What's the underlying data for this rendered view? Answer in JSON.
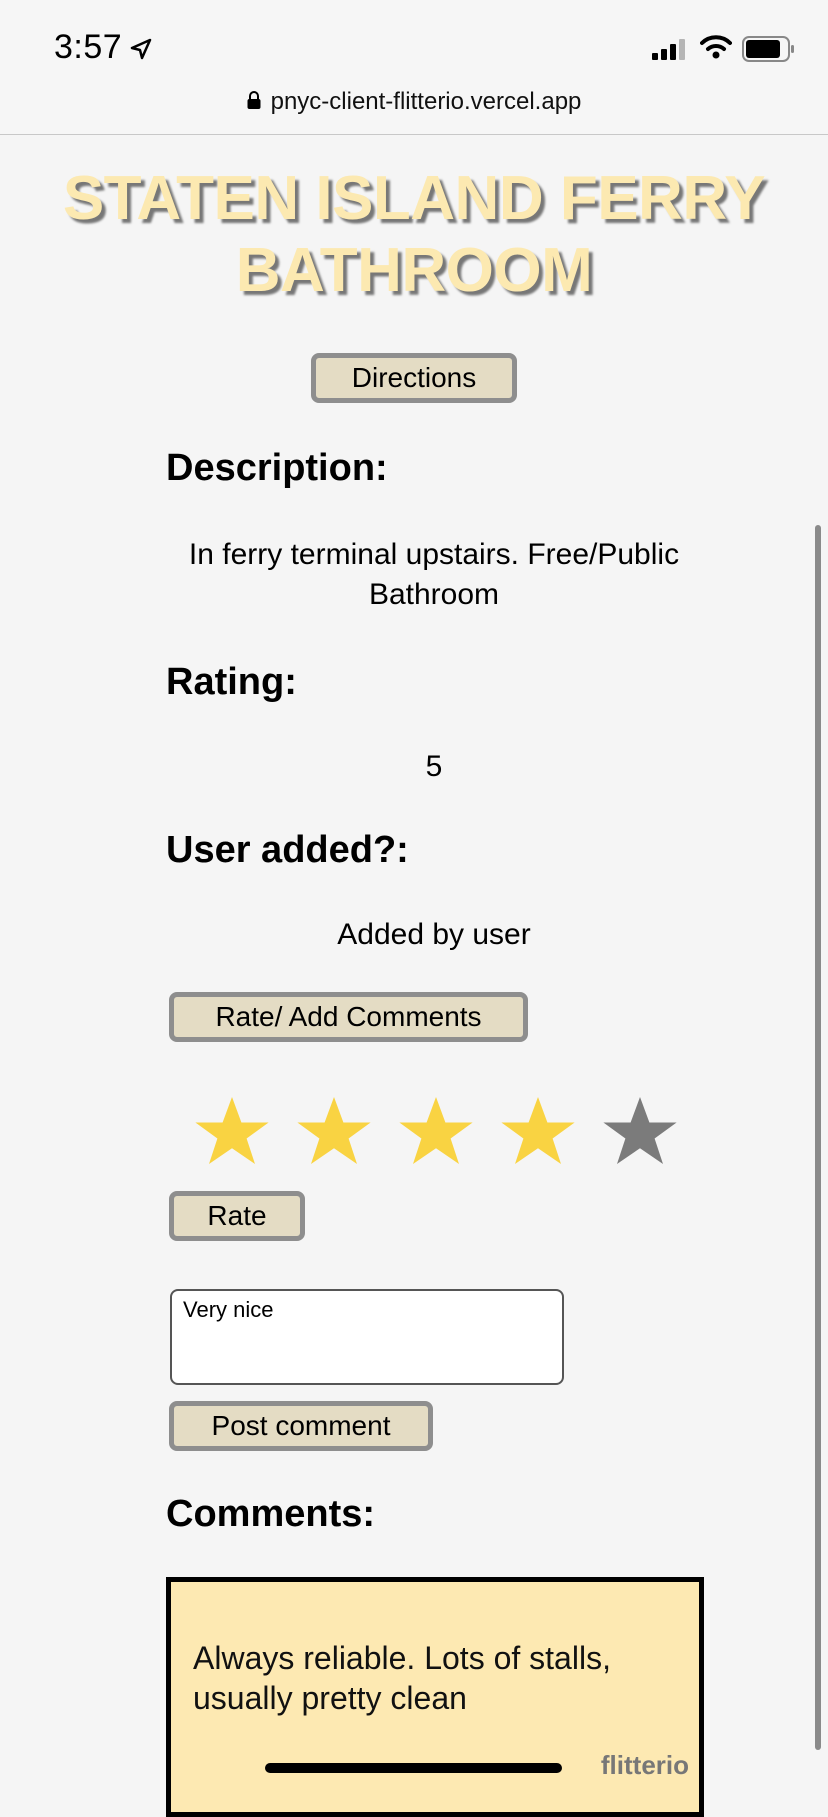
{
  "status_bar": {
    "time": "3:57",
    "location_icon": "location-arrow-icon",
    "signal_icon": "cellular-signal-icon",
    "wifi_icon": "wifi-icon",
    "battery_icon": "battery-icon"
  },
  "browser": {
    "url": "pnyc-client-flitterio.vercel.app",
    "lock_icon": "lock-icon"
  },
  "page": {
    "title_line1": "STATEN ISLAND FERRY",
    "title_line2": "BATHROOM",
    "directions_label": "Directions",
    "description_heading": "Description:",
    "description_text": "In ferry terminal upstairs. Free/Public Bathroom",
    "rating_heading": "Rating:",
    "rating_value": "5",
    "user_added_heading": "User added?:",
    "user_added_text": "Added by user",
    "rate_comments_label": "Rate/ Add Comments",
    "star_rating": {
      "selected": 4,
      "max": 5,
      "filled_color": "#f9d342",
      "empty_color": "#7b7b7b"
    },
    "rate_label": "Rate",
    "comment_input_value": "Very nice",
    "post_comment_label": "Post comment",
    "comments_heading": "Comments:",
    "comments": [
      {
        "text": "Always reliable. Lots of stalls, usually pretty clean"
      }
    ],
    "watermark": "flitterio"
  },
  "colors": {
    "title_fill": "#fce9b1",
    "button_bg": "#e4dcc4",
    "comment_card_bg": "#fde9b2"
  }
}
